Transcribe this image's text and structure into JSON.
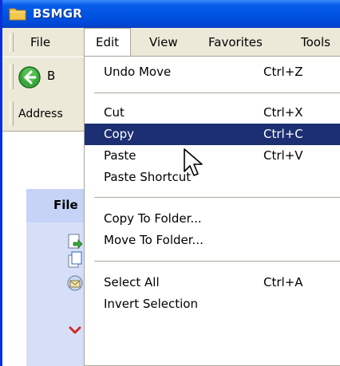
{
  "window": {
    "title": "BSMGR"
  },
  "menubar": {
    "items": [
      "File",
      "Edit",
      "View",
      "Favorites",
      "Tools"
    ],
    "active": "Edit"
  },
  "toolbar": {
    "back_trail": "B"
  },
  "addressbar": {
    "label": "Address"
  },
  "taskpane": {
    "title": "File"
  },
  "edit_menu": {
    "items": [
      {
        "label": "Undo Move",
        "shortcut": "Ctrl+Z"
      },
      {
        "label": "Cut",
        "shortcut": "Ctrl+X"
      },
      {
        "label": "Copy",
        "shortcut": "Ctrl+C"
      },
      {
        "label": "Paste",
        "shortcut": "Ctrl+V"
      },
      {
        "label": "Paste Shortcut",
        "shortcut": ""
      },
      {
        "label": "Copy To Folder...",
        "shortcut": ""
      },
      {
        "label": "Move To Folder...",
        "shortcut": ""
      },
      {
        "label": "Select All",
        "shortcut": "Ctrl+A"
      },
      {
        "label": "Invert Selection",
        "shortcut": ""
      }
    ]
  },
  "colors": {
    "titlebar": "#0054e3",
    "highlight": "#1c2f72",
    "menubar": "#ece9d8"
  }
}
